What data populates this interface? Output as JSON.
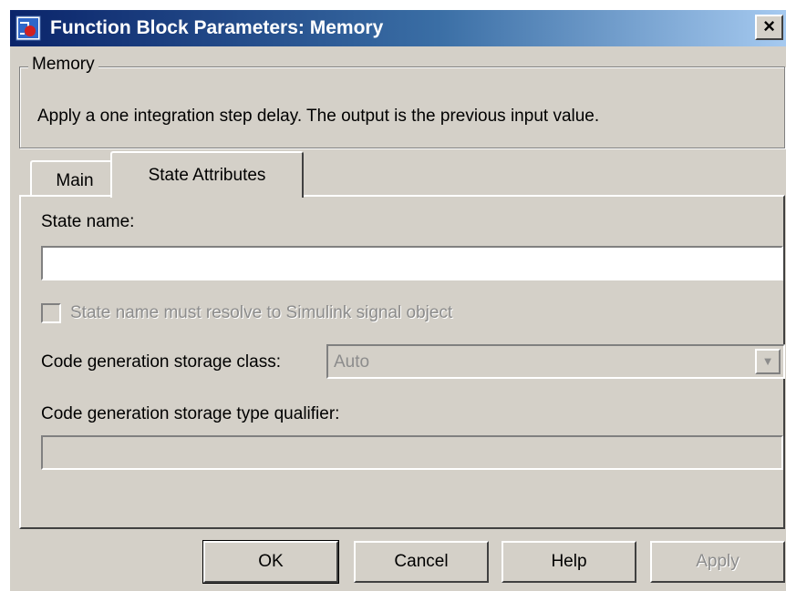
{
  "window": {
    "title": "Function Block Parameters: Memory",
    "close_label": "×",
    "icon": "simulink-block-icon"
  },
  "group": {
    "title": "Memory",
    "description": "Apply a one integration step delay. The output is the previous input value."
  },
  "tabs": [
    {
      "label": "Main",
      "selected": false
    },
    {
      "label": "State Attributes",
      "selected": true
    }
  ],
  "state_attributes": {
    "state_name_label": "State name:",
    "state_name_value": "",
    "resolve_checkbox_label": "State name must resolve to Simulink signal object",
    "resolve_checked": false,
    "storage_class_label": "Code generation storage class:",
    "storage_class_value": "Auto",
    "type_qualifier_label": "Code generation storage type qualifier:",
    "type_qualifier_value": ""
  },
  "buttons": {
    "ok": "OK",
    "cancel": "Cancel",
    "help": "Help",
    "apply": "Apply"
  }
}
